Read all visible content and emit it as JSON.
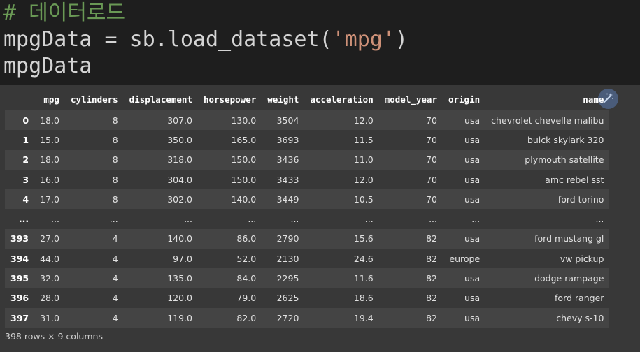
{
  "code": {
    "comment": "# 데이터로드",
    "line2_prefix": "mpgData = sb.load_dataset(",
    "line2_string": "'mpg'",
    "line2_suffix": ")",
    "line3": "mpgData"
  },
  "table": {
    "columns": [
      "",
      "mpg",
      "cylinders",
      "displacement",
      "horsepower",
      "weight",
      "acceleration",
      "model_year",
      "origin",
      "name"
    ],
    "rows": [
      [
        "0",
        "18.0",
        "8",
        "307.0",
        "130.0",
        "3504",
        "12.0",
        "70",
        "usa",
        "chevrolet chevelle malibu"
      ],
      [
        "1",
        "15.0",
        "8",
        "350.0",
        "165.0",
        "3693",
        "11.5",
        "70",
        "usa",
        "buick skylark 320"
      ],
      [
        "2",
        "18.0",
        "8",
        "318.0",
        "150.0",
        "3436",
        "11.0",
        "70",
        "usa",
        "plymouth satellite"
      ],
      [
        "3",
        "16.0",
        "8",
        "304.0",
        "150.0",
        "3433",
        "12.0",
        "70",
        "usa",
        "amc rebel sst"
      ],
      [
        "4",
        "17.0",
        "8",
        "302.0",
        "140.0",
        "3449",
        "10.5",
        "70",
        "usa",
        "ford torino"
      ],
      [
        "...",
        "...",
        "...",
        "...",
        "...",
        "...",
        "...",
        "...",
        "...",
        "..."
      ],
      [
        "393",
        "27.0",
        "4",
        "140.0",
        "86.0",
        "2790",
        "15.6",
        "82",
        "usa",
        "ford mustang gl"
      ],
      [
        "394",
        "44.0",
        "4",
        "97.0",
        "52.0",
        "2130",
        "24.6",
        "82",
        "europe",
        "vw pickup"
      ],
      [
        "395",
        "32.0",
        "4",
        "135.0",
        "84.0",
        "2295",
        "11.6",
        "82",
        "usa",
        "dodge rampage"
      ],
      [
        "396",
        "28.0",
        "4",
        "120.0",
        "79.0",
        "2625",
        "18.6",
        "82",
        "usa",
        "ford ranger"
      ],
      [
        "397",
        "31.0",
        "4",
        "119.0",
        "82.0",
        "2720",
        "19.4",
        "82",
        "usa",
        "chevy s-10"
      ]
    ]
  },
  "summary": "398 rows × 9 columns",
  "icons": {
    "magic": "magic-wand-icon"
  }
}
